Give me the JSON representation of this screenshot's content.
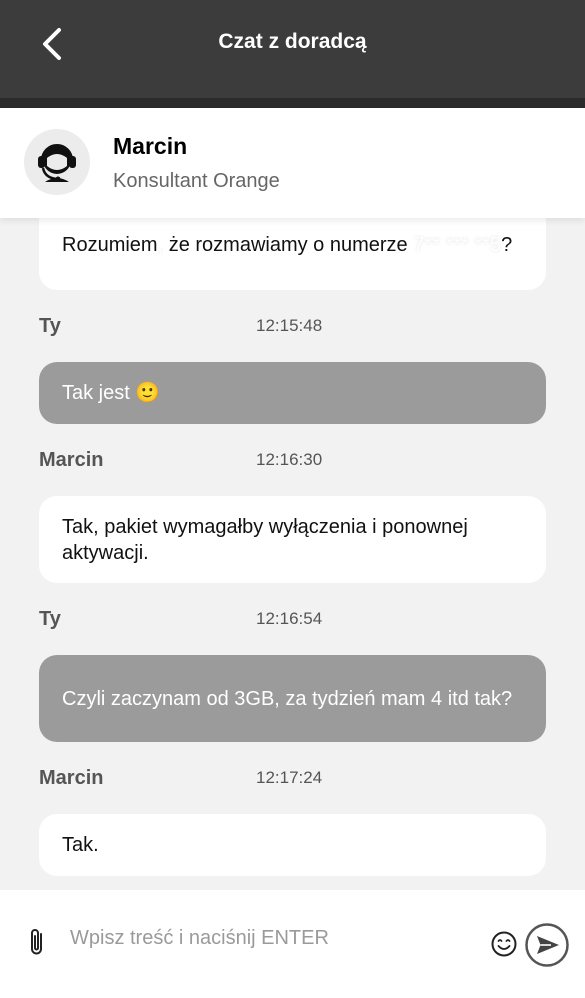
{
  "header": {
    "title": "Czat z doradcą",
    "back_icon": "chevron-left-icon"
  },
  "agent": {
    "name": "Marcin",
    "role": "Konsultant Orange",
    "avatar_icon": "headset-agent-icon"
  },
  "messages": [
    {
      "type": "agent",
      "text_before": "Rozumiem",
      "text_redacted_1": ", ",
      "text_middle": "że rozmawiamy o numerze ",
      "text_redacted_2": "7** *** **5",
      "text_after": "?"
    },
    {
      "sender": "Ty",
      "time": "12:15:48"
    },
    {
      "type": "user",
      "text": "Tak jest 🙂"
    },
    {
      "sender": "Marcin",
      "time": "12:16:30"
    },
    {
      "type": "agent",
      "text": "Tak, pakiet wymagałby wyłączenia i ponownej aktywacji."
    },
    {
      "sender": "Ty",
      "time": "12:16:54"
    },
    {
      "type": "user",
      "text": "Czyli zaczynam od 3GB, za tydzień mam 4 itd tak?"
    },
    {
      "sender": "Marcin",
      "time": "12:17:24"
    },
    {
      "type": "agent",
      "text": "Tak."
    }
  ],
  "composer": {
    "placeholder": "Wpisz treść i naciśnij ENTER",
    "value": "",
    "attach_icon": "paperclip-icon",
    "emoji_icon": "smiley-icon",
    "send_icon": "send-arrow-icon"
  },
  "colors": {
    "topbar": "#3c3c3c",
    "background": "#f2f2f2",
    "agent_bubble": "#ffffff",
    "user_bubble": "#9b9b9b"
  }
}
